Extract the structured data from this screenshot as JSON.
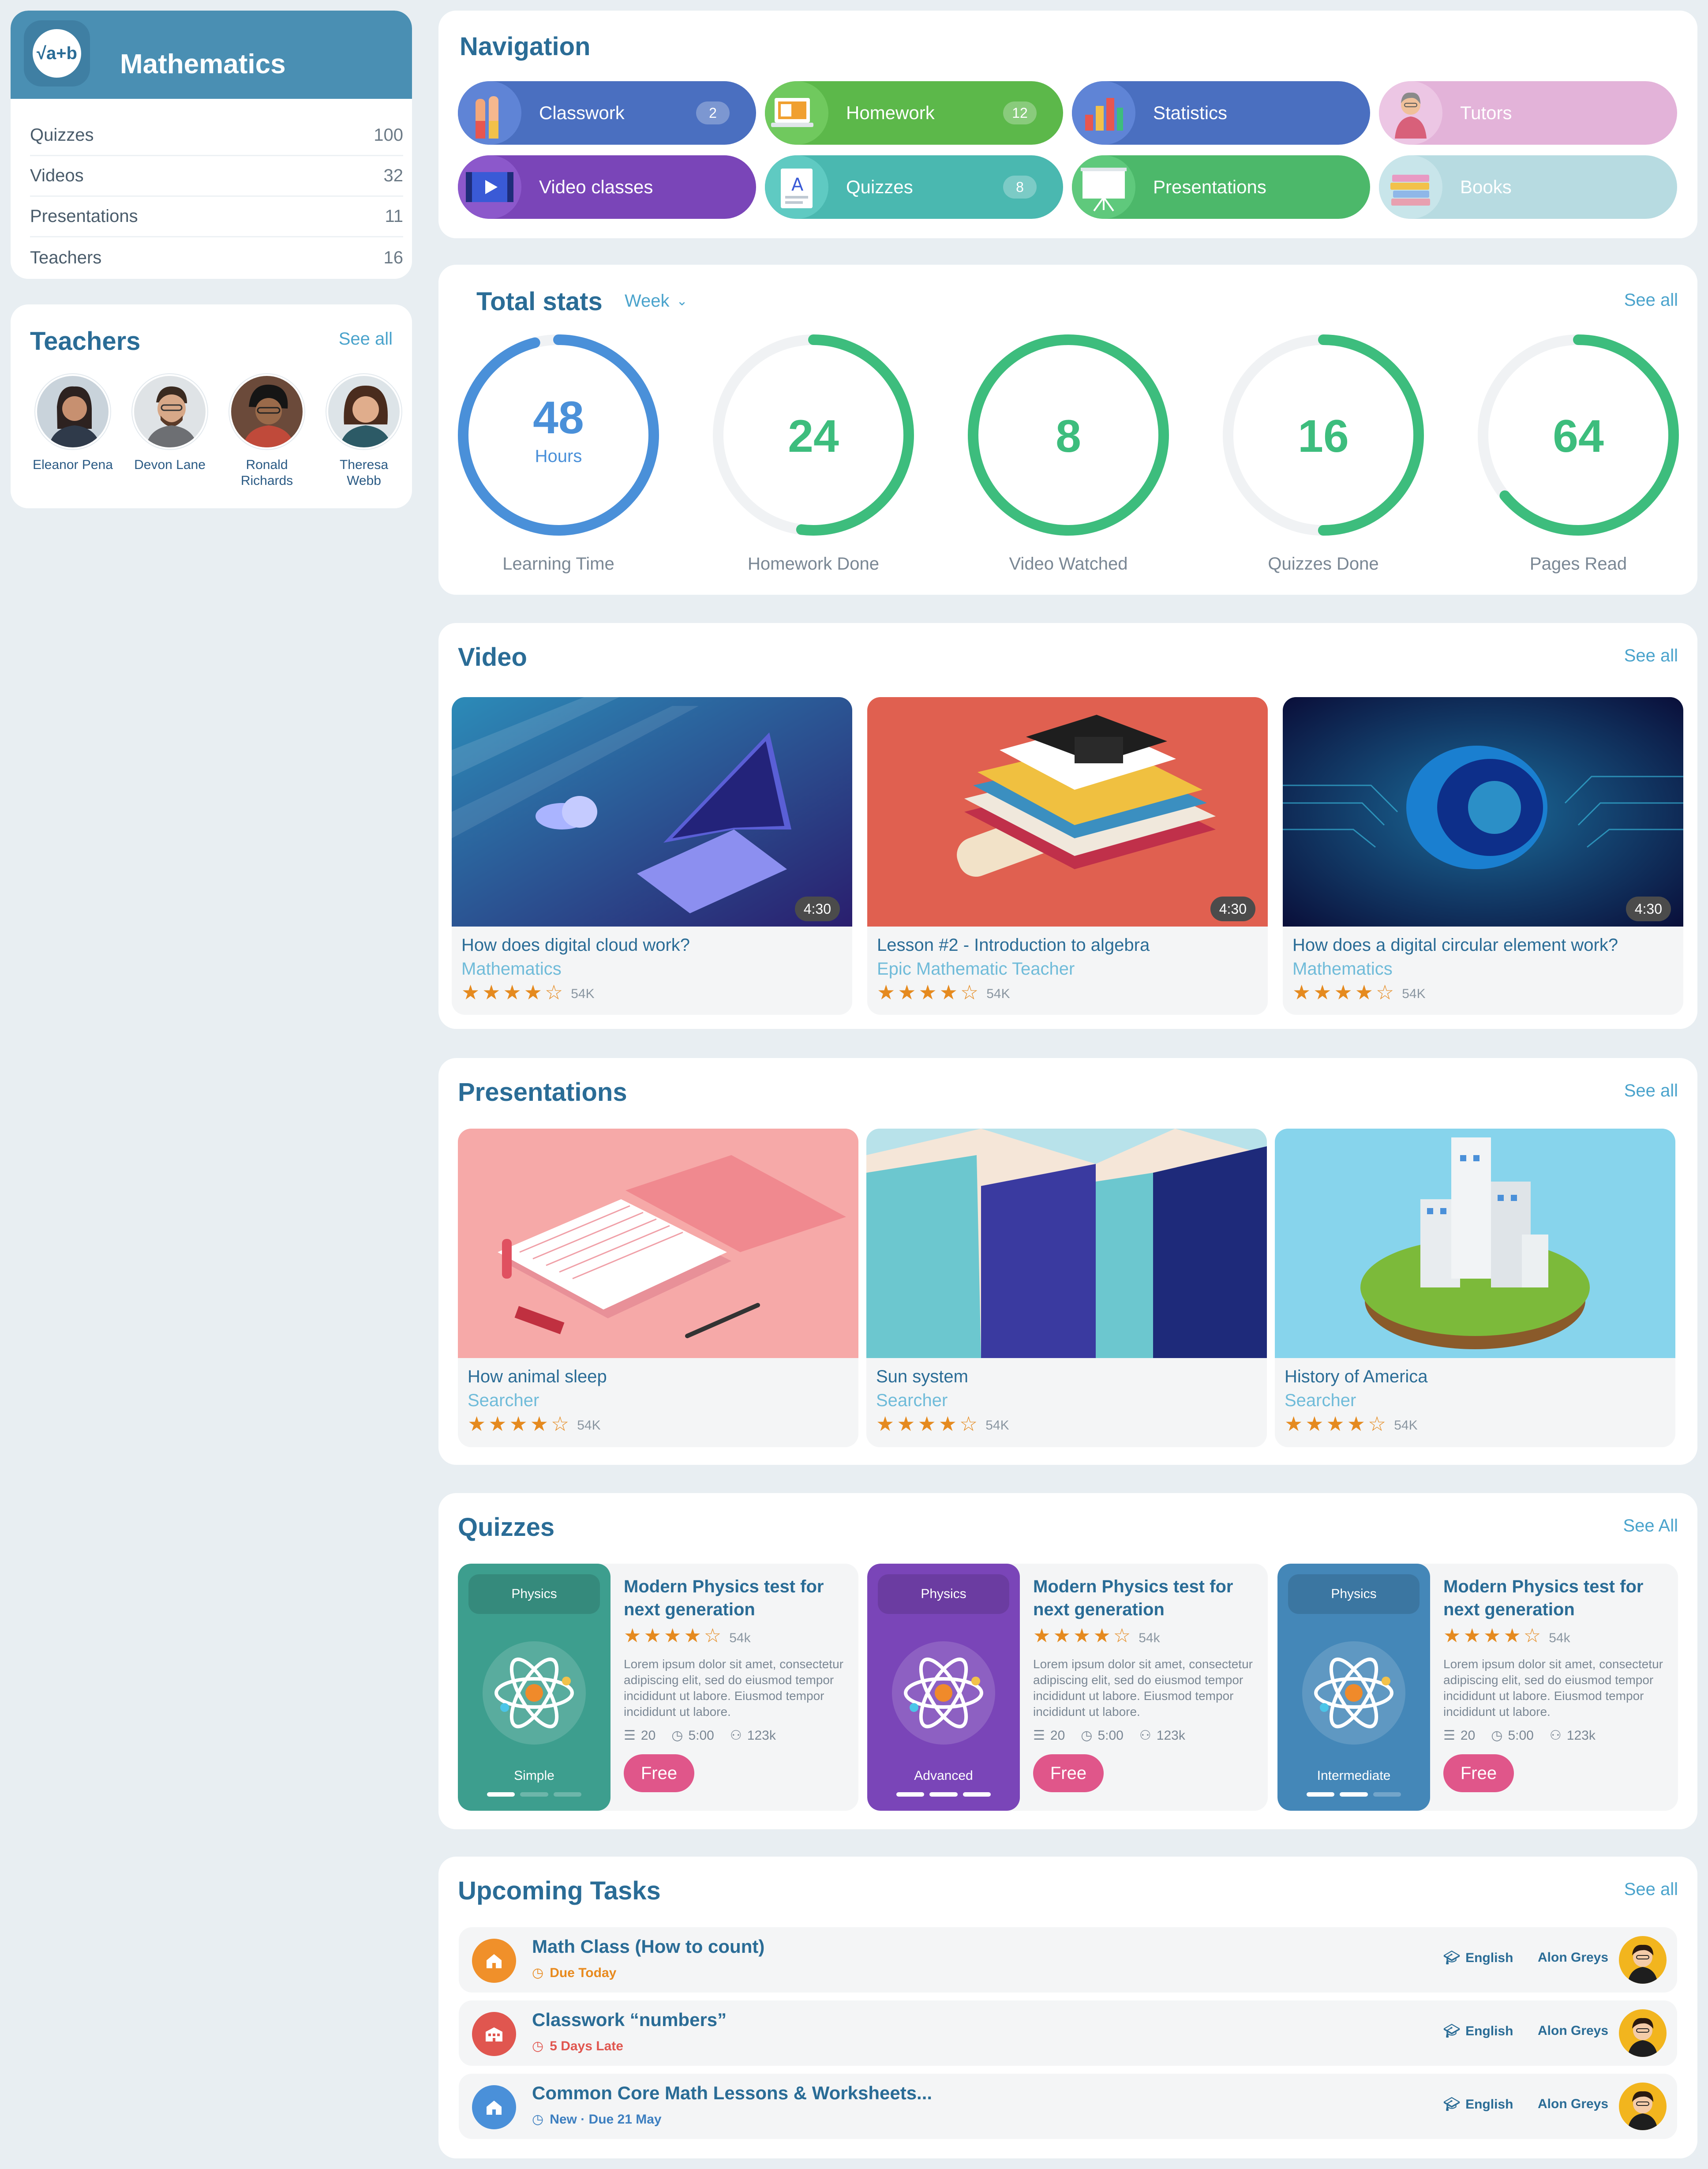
{
  "subject": {
    "title": "Mathematics",
    "logo_text": "√a+b",
    "rows": [
      {
        "label": "Quizzes",
        "value": "100"
      },
      {
        "label": "Videos",
        "value": "32"
      },
      {
        "label": "Presentations",
        "value": "11"
      },
      {
        "label": "Teachers",
        "value": "16"
      }
    ]
  },
  "teachers": {
    "title": "Teachers",
    "see_all": "See all",
    "items": [
      {
        "name": "Eleanor Pena"
      },
      {
        "name": "Devon Lane"
      },
      {
        "name": "Ronald Richards"
      },
      {
        "name": "Theresa Webb"
      }
    ]
  },
  "navigation": {
    "title": "Navigation",
    "items": [
      {
        "label": "Classwork",
        "badge": "2",
        "color": "#4a6fc0",
        "icon": "raised-hands-icon"
      },
      {
        "label": "Homework",
        "badge": "12",
        "color": "#5cb84a",
        "icon": "laptop-icon"
      },
      {
        "label": "Statistics",
        "badge": "",
        "color": "#4a6fc0",
        "icon": "bar-chart-icon"
      },
      {
        "label": "Tutors",
        "badge": "",
        "color": "#e3b3d9",
        "icon": "tutor-icon"
      },
      {
        "label": "Video classes",
        "badge": "",
        "color": "#7a45b8",
        "icon": "video-icon"
      },
      {
        "label": "Quizzes",
        "badge": "8",
        "color": "#4ab8b0",
        "icon": "quiz-icon"
      },
      {
        "label": "Presentations",
        "badge": "",
        "color": "#4cb86a",
        "icon": "presentation-board-icon"
      },
      {
        "label": "Books",
        "badge": "",
        "color": "#b7dbe1",
        "icon": "books-icon"
      }
    ]
  },
  "stats": {
    "title": "Total stats",
    "period": "Week",
    "see_all": "See all",
    "items": [
      {
        "value": "48",
        "unit": "Hours",
        "label": "Learning Time",
        "fraction": 0.96,
        "color": "#4a90d9"
      },
      {
        "value": "24",
        "unit": "",
        "label": "Homework Done",
        "fraction": 0.52,
        "color": "#3dbd7d"
      },
      {
        "value": "8",
        "unit": "",
        "label": "Video Watched",
        "fraction": 1.0,
        "color": "#3dbd7d"
      },
      {
        "value": "16",
        "unit": "",
        "label": "Quizzes Done",
        "fraction": 0.5,
        "color": "#3dbd7d"
      },
      {
        "value": "64",
        "unit": "",
        "label": "Pages Read",
        "fraction": 0.64,
        "color": "#3dbd7d"
      }
    ]
  },
  "video": {
    "title": "Video",
    "see_all": "See all",
    "items": [
      {
        "title": "How does digital cloud work?",
        "subtitle": "Mathematics",
        "duration": "4:30",
        "rating": 4,
        "count": "54K"
      },
      {
        "title": "Lesson #2 - Introduction to algebra",
        "subtitle": "Epic Mathematic Teacher",
        "duration": "4:30",
        "rating": 4,
        "count": "54K"
      },
      {
        "title": "How does a digital circular element work?",
        "subtitle": "Mathematics",
        "duration": "4:30",
        "rating": 4,
        "count": "54K"
      }
    ]
  },
  "presentations": {
    "title": "Presentations",
    "see_all": "See all",
    "items": [
      {
        "title": "How animal sleep",
        "subtitle": "Searcher",
        "rating": 4,
        "count": "54K"
      },
      {
        "title": "Sun system",
        "subtitle": "Searcher",
        "rating": 4,
        "count": "54K"
      },
      {
        "title": "History of America",
        "subtitle": "Searcher",
        "rating": 4,
        "count": "54K"
      }
    ]
  },
  "quizzes": {
    "title": "Quizzes",
    "see_all": "See All",
    "items": [
      {
        "tag": "Physics",
        "level": "Simple",
        "color": "#3d9e8e",
        "title": "Modern Physics test for next generation",
        "rating": 4,
        "count": "54k",
        "desc": "Lorem ipsum dolor sit amet, consectetur adipiscing elit, sed do eiusmod tempor incididunt ut labore. Eiusmod tempor incididunt ut labore.",
        "questions": "20",
        "time": "5:00",
        "people": "123k",
        "button": "Free",
        "progress": 1
      },
      {
        "tag": "Physics",
        "level": "Advanced",
        "color": "#7a45b8",
        "title": "Modern Physics test for next generation",
        "rating": 4,
        "count": "54k",
        "desc": "Lorem ipsum dolor sit amet, consectetur adipiscing elit, sed do eiusmod tempor incididunt ut labore. Eiusmod tempor incididunt ut labore.",
        "questions": "20",
        "time": "5:00",
        "people": "123k",
        "button": "Free",
        "progress": 3
      },
      {
        "tag": "Physics",
        "level": "Intermediate",
        "color": "#4487b8",
        "title": "Modern Physics test for next generation",
        "rating": 4,
        "count": "54k",
        "desc": "Lorem ipsum dolor sit amet, consectetur adipiscing elit, sed do eiusmod tempor incididunt ut labore. Eiusmod tempor incididunt ut labore.",
        "questions": "20",
        "time": "5:00",
        "people": "123k",
        "button": "Free",
        "progress": 2
      }
    ]
  },
  "tasks": {
    "title": "Upcoming Tasks",
    "see_all": "See all",
    "items": [
      {
        "title": "Math Class (How to count)",
        "due": "Due Today",
        "due_color": "#e88a1e",
        "icon_color": "#f0902a",
        "icon": "home-icon",
        "language": "English",
        "teacher": "Alon Greys"
      },
      {
        "title": "Classwork “numbers”",
        "due": "5 Days Late",
        "due_color": "#e0564f",
        "icon_color": "#e0564f",
        "icon": "school-icon",
        "language": "English",
        "teacher": "Alon Greys"
      },
      {
        "title": "Common Core Math Lessons & Worksheets...",
        "due": "New · Due 21 May",
        "due_color": "#3d7fc0",
        "icon_color": "#4a90d9",
        "icon": "home-icon",
        "language": "English",
        "teacher": "Alon Greys"
      }
    ]
  }
}
